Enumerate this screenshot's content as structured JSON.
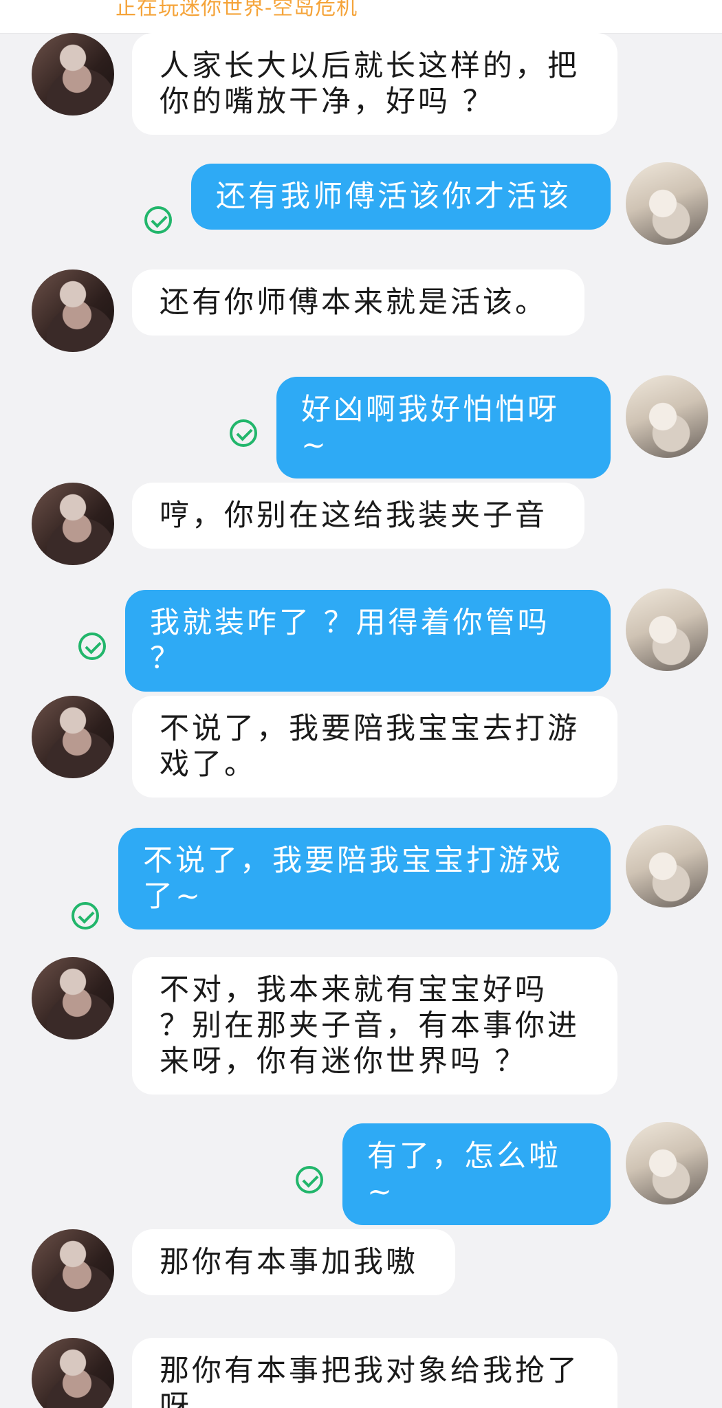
{
  "header": {
    "status_text": "正在玩迷你世界-空岛危机"
  },
  "colors": {
    "incoming_bubble": "#ffffff",
    "outgoing_bubble": "#2eaaf5",
    "read_check": "#22b66b",
    "status_text": "#f5a43a",
    "background": "#f2f2f4"
  },
  "messages": [
    {
      "from": "other",
      "text": "人家长大以后就长这样的，把你的嘴放干净，好吗 ？"
    },
    {
      "from": "me",
      "text": "还有我师傅活该你才活该",
      "status": "read-check-icon"
    },
    {
      "from": "other",
      "text": "还有你师傅本来就是活该。"
    },
    {
      "from": "me",
      "text": "好凶啊我好怕怕呀~",
      "status": "read-check-icon"
    },
    {
      "from": "other",
      "text": "哼，你别在这给我装夹子音"
    },
    {
      "from": "me",
      "text": "我就装咋了 ？用得着你管吗 ？",
      "status": "read-check-icon"
    },
    {
      "from": "other",
      "text": "不说了，我要陪我宝宝去打游戏了。"
    },
    {
      "from": "me",
      "text": "不说了，我要陪我宝宝打游戏了~",
      "status": "read-check-icon"
    },
    {
      "from": "other",
      "text": "不对，我本来就有宝宝好吗 ？别在那夹子音，有本事你进来呀，你有迷你世界吗 ？"
    },
    {
      "from": "me",
      "text": "有了，怎么啦~",
      "status": "read-check-icon"
    },
    {
      "from": "other",
      "text": "那你有本事加我嗷"
    },
    {
      "from": "other",
      "text": "那你有本事把我对象给我抢了呀"
    }
  ]
}
